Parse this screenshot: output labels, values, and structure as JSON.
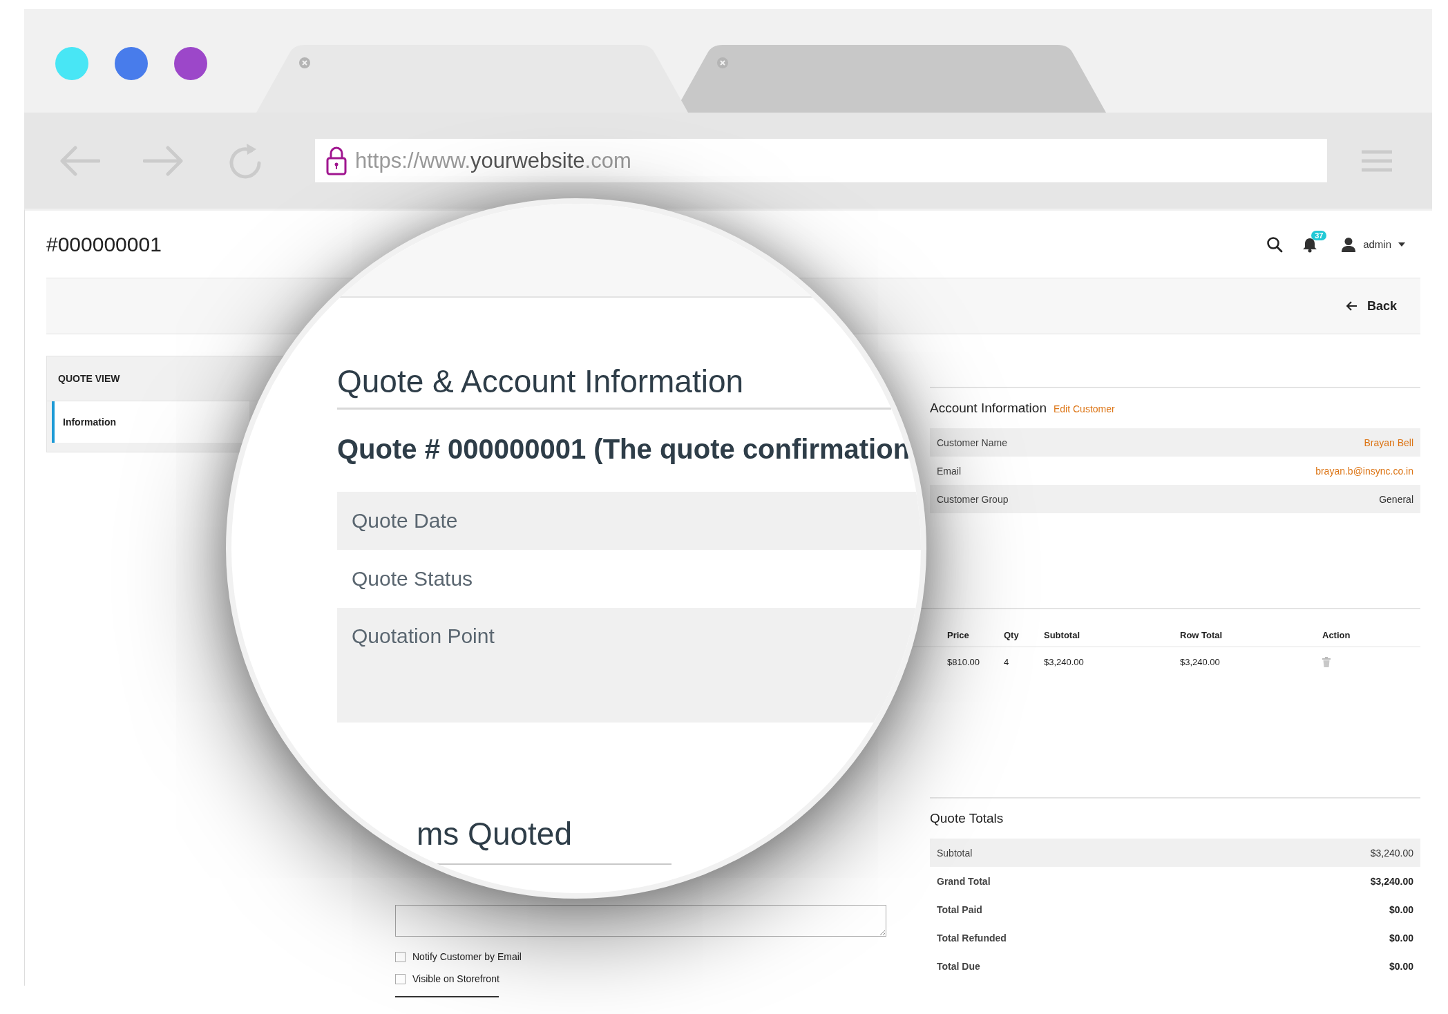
{
  "browser": {
    "tabs": [
      {
        "selected": true
      },
      {
        "selected": false
      }
    ],
    "url": {
      "scheme": "https://www.",
      "host": "yourwebsite",
      "suffix": ".com"
    }
  },
  "header": {
    "title": "#000000001",
    "notification_count": "37",
    "user": "admin"
  },
  "toolbar": {
    "back": "Back"
  },
  "sidebar": {
    "title": "QUOTE VIEW",
    "items": [
      {
        "label": "Information",
        "selected": true
      }
    ]
  },
  "magnifier": {
    "heading": "Quote & Account Information",
    "subheading": "Quote # 000000001 (The quote confirmation",
    "rows": [
      {
        "label": "Quote Date"
      },
      {
        "label": "Quote Status"
      },
      {
        "label": "Quotation Point"
      }
    ],
    "section": "ms Quoted"
  },
  "account": {
    "title": "Account Information",
    "edit_link": "Edit Customer",
    "rows": [
      {
        "label": "Customer Name",
        "value": "Brayan Bell",
        "kind": "link"
      },
      {
        "label": "Email",
        "value": "brayan.b@insync.co.in",
        "kind": "link"
      },
      {
        "label": "Customer Group",
        "value": "General",
        "kind": "plain"
      }
    ]
  },
  "items": {
    "columns": [
      "Price",
      "Qty",
      "Subtotal",
      "Row Total",
      "Action"
    ],
    "rows": [
      {
        "cells": [
          "$810.00",
          "4",
          "$3,240.00",
          "$3,240.00"
        ]
      }
    ]
  },
  "comment": {
    "checkboxes": [
      {
        "label": "Notify Customer by Email",
        "checked": false
      },
      {
        "label": "Visible on Storefront",
        "checked": false
      }
    ]
  },
  "totals": {
    "title": "Quote Totals",
    "rows": [
      {
        "label": "Subtotal",
        "value": "$3,240.00",
        "emphasis": false
      },
      {
        "label": "Grand Total",
        "value": "$3,240.00",
        "emphasis": true
      },
      {
        "label": "Total Paid",
        "value": "$0.00",
        "emphasis": true
      },
      {
        "label": "Total Refunded",
        "value": "$0.00",
        "emphasis": true
      },
      {
        "label": "Total Due",
        "value": "$0.00",
        "emphasis": true
      }
    ]
  }
}
